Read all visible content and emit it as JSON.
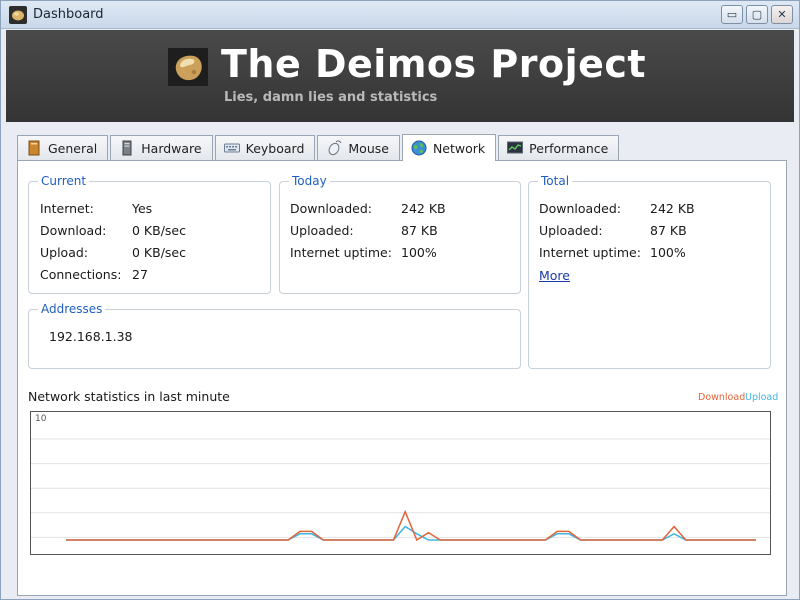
{
  "window": {
    "title": "Dashboard",
    "buttons": {
      "minimize": "▭",
      "maximize": "▢",
      "close": "✕"
    }
  },
  "banner": {
    "title": "The Deimos Project",
    "subtitle": "Lies, damn lies and statistics",
    "icon": "deimos-moon-icon"
  },
  "tabs": [
    {
      "label": "General",
      "icon": "general-icon",
      "active": false
    },
    {
      "label": "Hardware",
      "icon": "hardware-icon",
      "active": false
    },
    {
      "label": "Keyboard",
      "icon": "keyboard-icon",
      "active": false
    },
    {
      "label": "Mouse",
      "icon": "mouse-icon",
      "active": false
    },
    {
      "label": "Network",
      "icon": "globe-icon",
      "active": true
    },
    {
      "label": "Performance",
      "icon": "performance-icon",
      "active": false
    }
  ],
  "current": {
    "title": "Current",
    "internet_label": "Internet:",
    "internet_value": "Yes",
    "download_label": "Download:",
    "download_value": "0 KB/sec",
    "upload_label": "Upload:",
    "upload_value": "0 KB/sec",
    "connections_label": "Connections:",
    "connections_value": "27"
  },
  "today": {
    "title": "Today",
    "downloaded_label": "Downloaded:",
    "downloaded_value": "242 KB",
    "uploaded_label": "Uploaded:",
    "uploaded_value": "87 KB",
    "uptime_label": "Internet uptime:",
    "uptime_value": "100%"
  },
  "total": {
    "title": "Total",
    "downloaded_label": "Downloaded:",
    "downloaded_value": "242 KB",
    "uploaded_label": "Uploaded:",
    "uploaded_value": "87 KB",
    "uptime_label": "Internet uptime:",
    "uptime_value": "100%",
    "more_link": "More"
  },
  "addresses": {
    "title": "Addresses",
    "items": [
      "192.168.1.38"
    ]
  },
  "chart_data": {
    "type": "line",
    "title": "Network statistics in last minute",
    "ylim": [
      0,
      10
    ],
    "ytick_label": "10",
    "grid": true,
    "legend": "top-right",
    "x": [
      0,
      1,
      2,
      3,
      4,
      5,
      6,
      7,
      8,
      9,
      10,
      11,
      12,
      13,
      14,
      15,
      16,
      17,
      18,
      19,
      20,
      21,
      22,
      23,
      24,
      25,
      26,
      27,
      28,
      29,
      30,
      31,
      32,
      33,
      34,
      35,
      36,
      37,
      38,
      39,
      40,
      41,
      42,
      43,
      44,
      45,
      46,
      47,
      48,
      49,
      50,
      51,
      52,
      53,
      54,
      55,
      56,
      57,
      58,
      59
    ],
    "series": [
      {
        "name": "Download",
        "color": "#e0653a",
        "values": [
          0,
          0,
          0,
          0,
          0,
          0,
          0,
          0,
          0,
          0,
          0,
          0,
          0,
          0,
          0,
          0,
          0,
          0,
          0,
          0,
          0.7,
          0.7,
          0,
          0,
          0,
          0,
          0,
          0,
          0,
          2.3,
          0,
          0.6,
          0,
          0,
          0,
          0,
          0,
          0,
          0,
          0,
          0,
          0,
          0.7,
          0.7,
          0,
          0,
          0,
          0,
          0,
          0,
          0,
          0,
          0,
          0,
          0,
          0,
          0,
          0,
          0,
          0
        ]
      },
      {
        "name": "Upload",
        "color": "#3fb6e0",
        "values": [
          0,
          0,
          0,
          0,
          0,
          0,
          0,
          0,
          0,
          0,
          0,
          0,
          0,
          0,
          0,
          0,
          0,
          0,
          0,
          0,
          0.5,
          0.5,
          0,
          0,
          0,
          0,
          0,
          0,
          0,
          1.1,
          0.5,
          0,
          0,
          0,
          0,
          0,
          0,
          0,
          0,
          0,
          0,
          0,
          0.5,
          0.5,
          0,
          0,
          0,
          0,
          0,
          0,
          0,
          0,
          0,
          0,
          0,
          0,
          0,
          0,
          0,
          0
        ]
      }
    ],
    "spikes_download": [
      {
        "x": 52,
        "value": 1.1
      }
    ],
    "spikes_upload": [
      {
        "x": 52,
        "value": 0.5
      }
    ]
  }
}
